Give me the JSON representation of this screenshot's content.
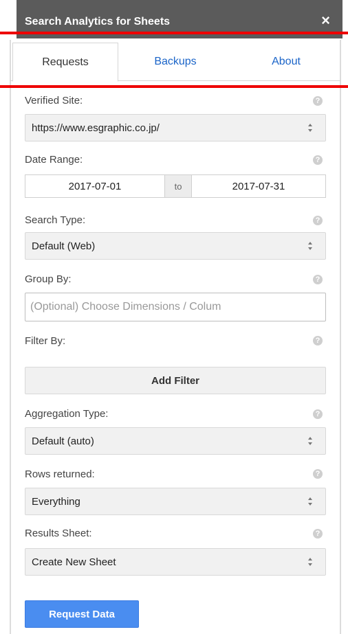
{
  "window": {
    "title": "Search Analytics for Sheets",
    "close_glyph": "×"
  },
  "tabs": [
    {
      "label": "Requests",
      "active": true
    },
    {
      "label": "Backups",
      "active": false
    },
    {
      "label": "About",
      "active": false
    }
  ],
  "form": {
    "verified_site": {
      "label": "Verified Site:",
      "value": "https://www.esgraphic.co.jp/"
    },
    "date_range": {
      "label": "Date Range:",
      "start": "2017-07-01",
      "separator": "to",
      "end": "2017-07-31"
    },
    "search_type": {
      "label": "Search Type:",
      "value": "Default (Web)"
    },
    "group_by": {
      "label": "Group By:",
      "placeholder": "(Optional) Choose Dimensions / Colum"
    },
    "filter_by": {
      "label": "Filter By:",
      "button": "Add Filter"
    },
    "aggregation_type": {
      "label": "Aggregation Type:",
      "value": "Default (auto)"
    },
    "rows_returned": {
      "label": "Rows returned:",
      "value": "Everything"
    },
    "results_sheet": {
      "label": "Results Sheet:",
      "value": "Create New Sheet"
    },
    "submit": "Request Data"
  },
  "icons": {
    "help": "help-circle-icon",
    "select_arrows": "select-arrows-icon",
    "close": "close-icon"
  },
  "colors": {
    "titlebar": "#5b5b5b",
    "link": "#1a64c8",
    "primary": "#4a8df0",
    "annotation": "#ee0000"
  }
}
